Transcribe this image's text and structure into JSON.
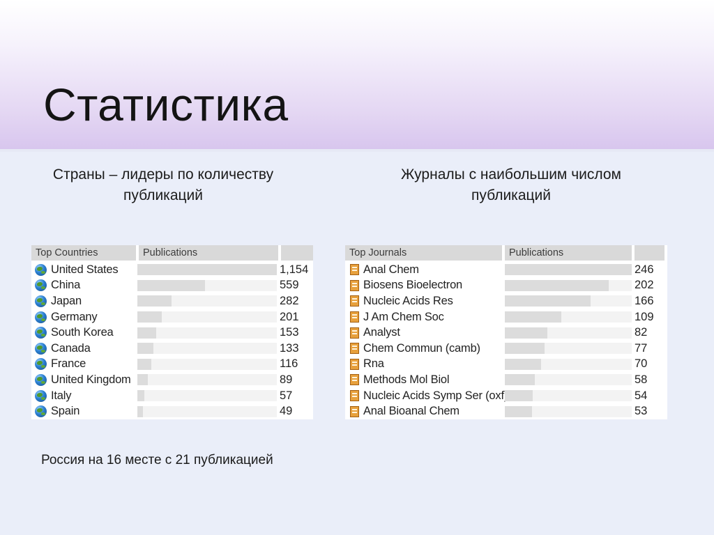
{
  "title": "Статистика",
  "captions": {
    "countries": "Страны – лидеры по количеству публикаций",
    "journals": "Журналы с наибольшим числом публикаций"
  },
  "footnote": "Россия на 16 месте с 21 публикацией",
  "countries_table": {
    "headers": [
      "Top Countries",
      "Publications",
      ""
    ],
    "icon": "globe-icon",
    "max": 1154,
    "rows": [
      {
        "name": "United States",
        "value": 1154,
        "label": "1,154"
      },
      {
        "name": "China",
        "value": 559,
        "label": "559"
      },
      {
        "name": "Japan",
        "value": 282,
        "label": "282"
      },
      {
        "name": "Germany",
        "value": 201,
        "label": "201"
      },
      {
        "name": "South Korea",
        "value": 153,
        "label": "153"
      },
      {
        "name": "Canada",
        "value": 133,
        "label": "133"
      },
      {
        "name": "France",
        "value": 116,
        "label": "116"
      },
      {
        "name": "United Kingdom",
        "value": 89,
        "label": "89"
      },
      {
        "name": "Italy",
        "value": 57,
        "label": "57"
      },
      {
        "name": "Spain",
        "value": 49,
        "label": "49"
      }
    ]
  },
  "journals_table": {
    "headers": [
      "Top Journals",
      "Publications",
      ""
    ],
    "icon": "journal-icon",
    "max": 246,
    "rows": [
      {
        "name": "Anal Chem",
        "value": 246,
        "label": "246"
      },
      {
        "name": "Biosens Bioelectron",
        "value": 202,
        "label": "202"
      },
      {
        "name": "Nucleic Acids Res",
        "value": 166,
        "label": "166"
      },
      {
        "name": "J Am Chem Soc",
        "value": 109,
        "label": "109"
      },
      {
        "name": "Analyst",
        "value": 82,
        "label": "82"
      },
      {
        "name": "Chem Commun (camb)",
        "value": 77,
        "label": "77"
      },
      {
        "name": "Rna",
        "value": 70,
        "label": "70"
      },
      {
        "name": "Methods Mol Biol",
        "value": 58,
        "label": "58"
      },
      {
        "name": "Nucleic Acids Symp Ser (oxf)",
        "value": 54,
        "label": "54"
      },
      {
        "name": "Anal Bioanal Chem",
        "value": 53,
        "label": "53"
      }
    ]
  }
}
